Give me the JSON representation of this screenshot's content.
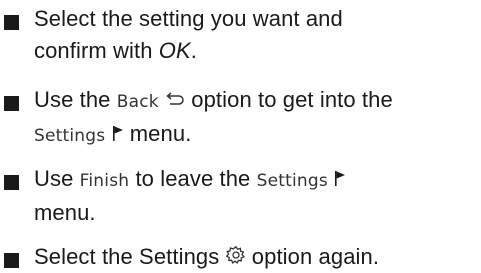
{
  "instructions": [
    {
      "line1_a": "Select the setting you want and",
      "line2_a": "confirm with ",
      "line2_ok": "OK",
      "line2_b": "."
    },
    {
      "line1_a": "Use the ",
      "line1_ui_back": "Back",
      "line1_b": " option to get into the",
      "line2_ui_settings": "Settings",
      "line2_b": " menu.",
      "icons": [
        "back-arrow-icon",
        "flag-icon"
      ]
    },
    {
      "line1_a": "Use ",
      "line1_ui_finish": "Finish",
      "line1_b": " to leave the ",
      "line1_ui_settings": "Settings",
      "line2_a": "menu.",
      "icons": [
        "flag-icon"
      ]
    },
    {
      "line1_a": "Select the Settings ",
      "line1_b": " option again.",
      "icons": [
        "gear-icon"
      ]
    }
  ]
}
